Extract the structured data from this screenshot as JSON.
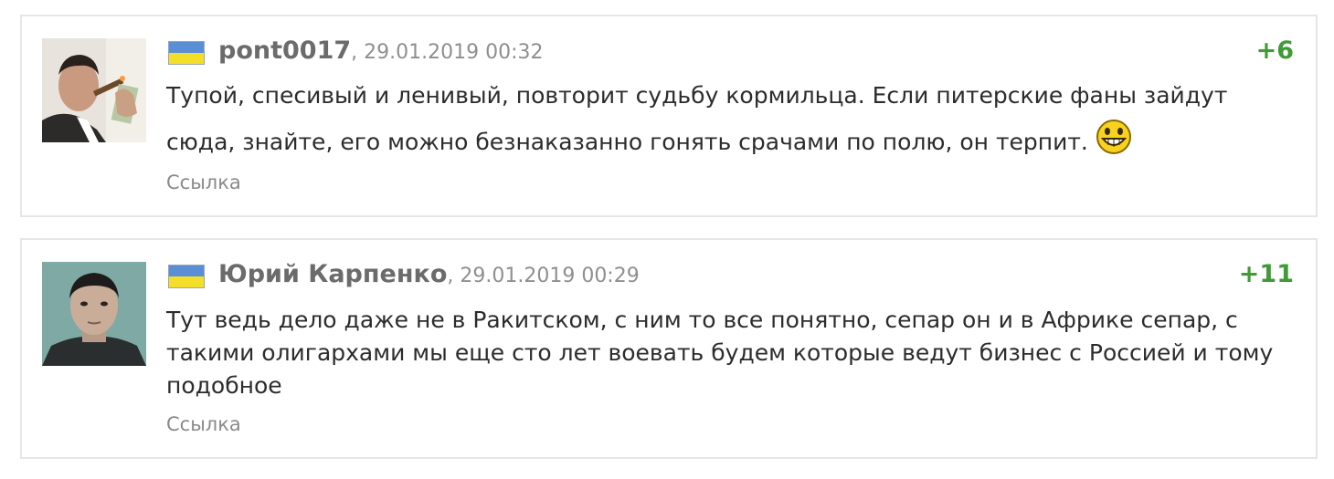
{
  "comments": [
    {
      "author": "pont0017",
      "date": ", 29.01.2019 00:32",
      "score": "+6",
      "text": "Тупой, спесивый и ленивый, повторит судьбу кормильца. Если питерские фаны зайдут сюда, знайте, его можно безнаказанно гонять срачами по полю, он терпит.",
      "link": "Ссылка",
      "avatar": "man-smoking-cigar-avatar",
      "flag": "ukraine-flag-icon",
      "emoji": "grinning-face-icon"
    },
    {
      "author": "Юрий Карпенко",
      "date": ", 29.01.2019 00:29",
      "score": "+11",
      "text": "Тут ведь дело даже не в Ракитском, с ним то все понятно, сепар он и в Африке сепар, с такими олигархами мы еще сто лет воевать будем которые ведут бизнес с Россией и тому подобное",
      "link": "Ссылка",
      "avatar": "man-portrait-avatar",
      "flag": "ukraine-flag-icon"
    }
  ],
  "colors": {
    "score": "#3f9b35",
    "author": "#6b6b6b",
    "meta": "#8f8f8f",
    "border": "#e6e6e6",
    "flag_blue": "#5a8fd6",
    "flag_yellow": "#f3de2a"
  }
}
